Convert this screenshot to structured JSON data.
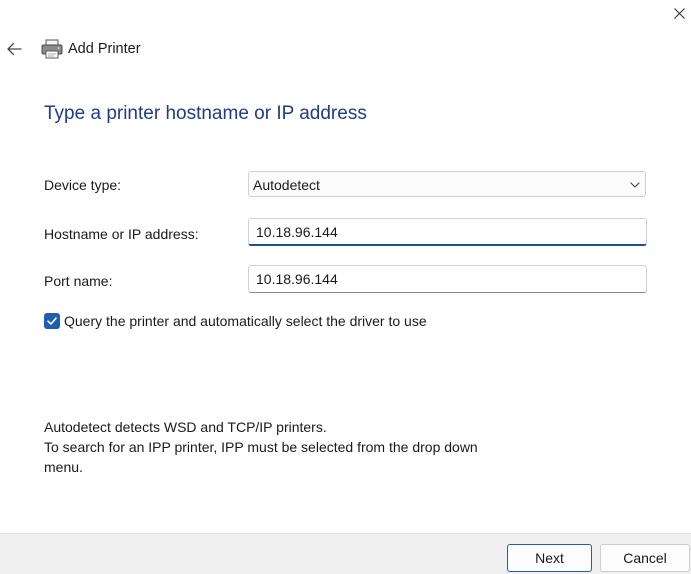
{
  "window": {
    "title": "Add Printer"
  },
  "page": {
    "heading": "Type a printer hostname or IP address"
  },
  "form": {
    "device_type": {
      "label": "Device type:",
      "value": "Autodetect"
    },
    "hostname": {
      "label": "Hostname or IP address:",
      "value": "10.18.96.144"
    },
    "port": {
      "label": "Port name:",
      "value": "10.18.96.144"
    },
    "query_checkbox": {
      "label": "Query the printer and automatically select the driver to use",
      "checked": true
    }
  },
  "info": {
    "line1": "Autodetect detects WSD and TCP/IP printers.",
    "line2": "To search for an IPP printer, IPP must be selected from the drop down",
    "line3": "menu."
  },
  "footer": {
    "next_label": "Next",
    "cancel_label": "Cancel"
  },
  "icons": {
    "close": "close-icon",
    "back": "back-arrow-icon",
    "printer": "printer-icon",
    "dropdown": "chevron-down-icon",
    "check": "checkmark-icon"
  },
  "colors": {
    "heading": "#1f3b8a",
    "accent": "#1f5fae",
    "footer_bg": "#f0f0f0"
  }
}
